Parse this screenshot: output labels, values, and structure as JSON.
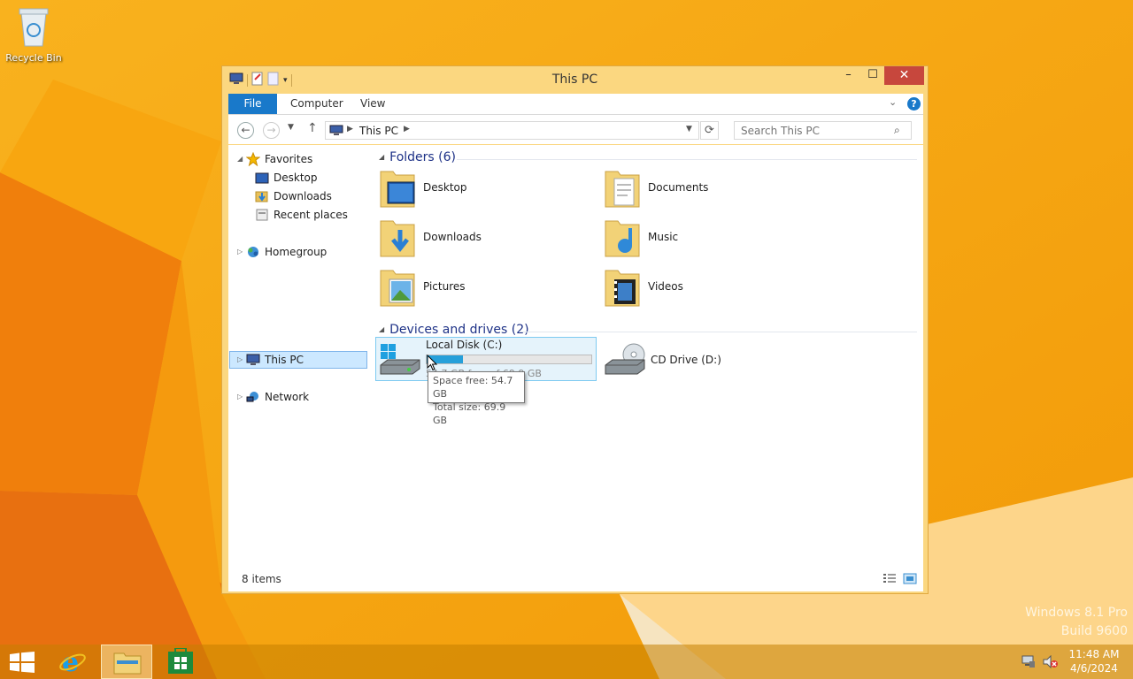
{
  "desktop": {
    "recycle_bin_label": "Recycle Bin",
    "watermark_line1": "Windows 8.1 Pro",
    "watermark_line2": "Build 9600"
  },
  "window": {
    "title": "This PC",
    "controls": {
      "minimize": "–",
      "maximize": "☐",
      "close": "✕"
    }
  },
  "ribbon": {
    "tabs": [
      {
        "label": "File"
      },
      {
        "label": "Computer"
      },
      {
        "label": "View"
      }
    ],
    "help_label": "?"
  },
  "address_bar": {
    "breadcrumb": "This PC",
    "search_placeholder": "Search This PC"
  },
  "nav_pane": {
    "favorites": {
      "label": "Favorites",
      "items": [
        {
          "label": "Desktop"
        },
        {
          "label": "Downloads"
        },
        {
          "label": "Recent places"
        }
      ]
    },
    "homegroup": "Homegroup",
    "this_pc": "This PC",
    "network": "Network"
  },
  "main": {
    "folders_header": "Folders (6)",
    "folders": [
      {
        "name": "Desktop"
      },
      {
        "name": "Documents"
      },
      {
        "name": "Downloads"
      },
      {
        "name": "Music"
      },
      {
        "name": "Pictures"
      },
      {
        "name": "Videos"
      }
    ],
    "drives_header": "Devices and drives (2)",
    "drives": [
      {
        "name": "Local Disk (C:)",
        "sub_text": "54.7 GB free of 69.9 GB",
        "used_fraction": 0.22
      },
      {
        "name": "CD Drive (D:)"
      }
    ],
    "tooltip": {
      "line1": "Space free: 54.7 GB",
      "line2": "Total size: 69.9 GB"
    }
  },
  "status": {
    "item_count": "8 items"
  },
  "taskbar": {
    "time": "11:48 AM",
    "date": "4/6/2024"
  },
  "colors": {
    "accent": "#1979ca",
    "selection": "#cce8ff",
    "window_frame": "#fbd780",
    "close_button": "#c7473d",
    "usage_bar": "#26a0da"
  }
}
